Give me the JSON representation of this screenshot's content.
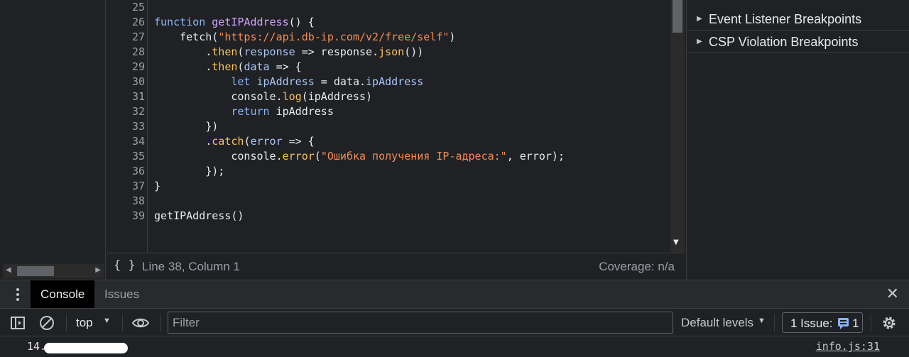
{
  "editor": {
    "lines": [
      {
        "n": "25",
        "tokens": []
      },
      {
        "n": "26",
        "tokens": [
          {
            "t": "function ",
            "c": "kw"
          },
          {
            "t": "getIPAddress",
            "c": "fn"
          },
          {
            "t": "() {",
            "c": ""
          }
        ]
      },
      {
        "n": "27",
        "tokens": [
          {
            "t": "    fetch(",
            "c": ""
          },
          {
            "t": "\"https://api.db-ip.com/v2/free/self\"",
            "c": "str"
          },
          {
            "t": ")",
            "c": ""
          }
        ]
      },
      {
        "n": "28",
        "tokens": [
          {
            "t": "        .",
            "c": ""
          },
          {
            "t": "then",
            "c": "prop"
          },
          {
            "t": "(",
            "c": ""
          },
          {
            "t": "response",
            "c": "var"
          },
          {
            "t": " => response.",
            "c": ""
          },
          {
            "t": "json",
            "c": "prop"
          },
          {
            "t": "())",
            "c": ""
          }
        ]
      },
      {
        "n": "29",
        "tokens": [
          {
            "t": "        .",
            "c": ""
          },
          {
            "t": "then",
            "c": "prop"
          },
          {
            "t": "(",
            "c": ""
          },
          {
            "t": "data",
            "c": "var"
          },
          {
            "t": " => {",
            "c": ""
          }
        ]
      },
      {
        "n": "30",
        "tokens": [
          {
            "t": "            ",
            "c": ""
          },
          {
            "t": "let ",
            "c": "kw"
          },
          {
            "t": "ipAddress",
            "c": "var"
          },
          {
            "t": " = data.",
            "c": ""
          },
          {
            "t": "ipAddress",
            "c": "var"
          }
        ]
      },
      {
        "n": "31",
        "tokens": [
          {
            "t": "            console.",
            "c": ""
          },
          {
            "t": "log",
            "c": "prop"
          },
          {
            "t": "(ipAddress)",
            "c": ""
          }
        ]
      },
      {
        "n": "32",
        "tokens": [
          {
            "t": "            ",
            "c": ""
          },
          {
            "t": "return",
            "c": "kw"
          },
          {
            "t": " ipAddress",
            "c": ""
          }
        ]
      },
      {
        "n": "33",
        "tokens": [
          {
            "t": "        })",
            "c": ""
          }
        ]
      },
      {
        "n": "34",
        "tokens": [
          {
            "t": "        .",
            "c": ""
          },
          {
            "t": "catch",
            "c": "prop"
          },
          {
            "t": "(",
            "c": ""
          },
          {
            "t": "error",
            "c": "var"
          },
          {
            "t": " => {",
            "c": ""
          }
        ]
      },
      {
        "n": "35",
        "tokens": [
          {
            "t": "            console.",
            "c": ""
          },
          {
            "t": "error",
            "c": "prop"
          },
          {
            "t": "(",
            "c": ""
          },
          {
            "t": "\"Ошибка получения IP-адреса:\"",
            "c": "str"
          },
          {
            "t": ", error);",
            "c": ""
          }
        ]
      },
      {
        "n": "36",
        "tokens": [
          {
            "t": "        });",
            "c": ""
          }
        ]
      },
      {
        "n": "37",
        "tokens": [
          {
            "t": "}",
            "c": ""
          }
        ]
      },
      {
        "n": "38",
        "tokens": []
      },
      {
        "n": "39",
        "tokens": [
          {
            "t": "getIPAddress()",
            "c": ""
          }
        ]
      }
    ]
  },
  "statusbar": {
    "format_icon": "{ }",
    "position": "Line 38, Column 1",
    "coverage": "Coverage: n/a"
  },
  "sidebar": {
    "sections": [
      {
        "label": "Event Listener Breakpoints"
      },
      {
        "label": "CSP Violation Breakpoints"
      }
    ]
  },
  "drawer": {
    "tabs": [
      {
        "label": "Console",
        "active": true
      },
      {
        "label": "Issues",
        "active": false
      }
    ]
  },
  "toolbar": {
    "context": "top",
    "filter_placeholder": "Filter",
    "levels": "Default levels",
    "issues_label": "1 Issue:",
    "issues_count": "1"
  },
  "console": {
    "message_prefix": "14.",
    "source": "info.js:31"
  },
  "icons": {
    "sidebar_toggle": "sidebar-toggle-icon",
    "clear": "clear-console-icon",
    "eye": "live-expression-eye-icon",
    "settings": "gear-icon",
    "close": "close-icon",
    "menu": "kebab-menu-icon"
  }
}
